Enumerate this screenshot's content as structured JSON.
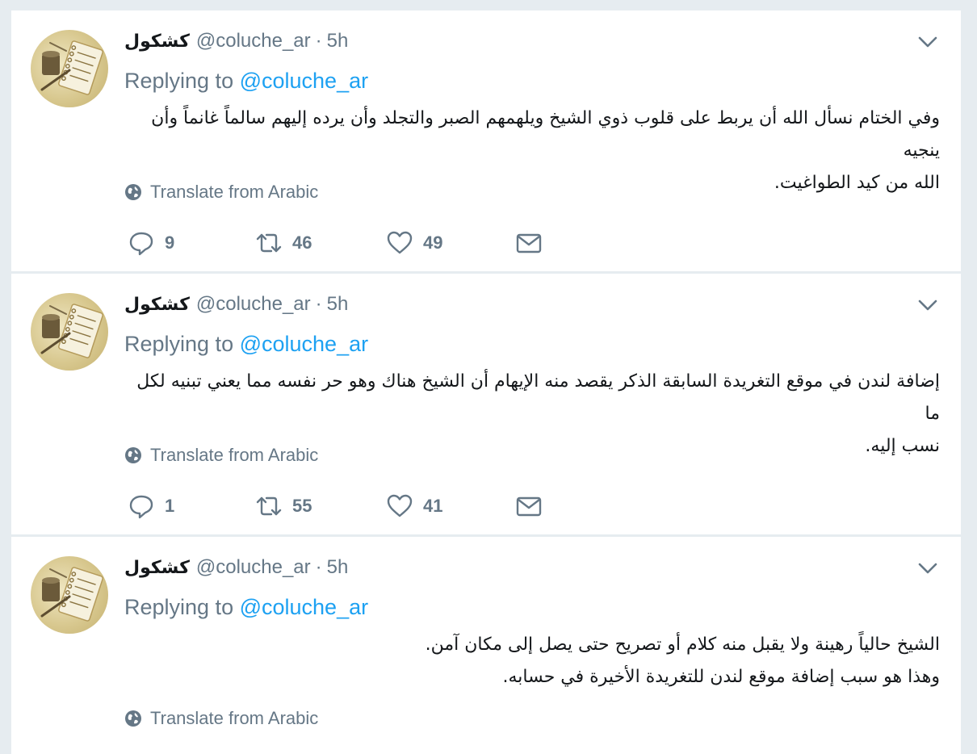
{
  "tweets": [
    {
      "fullname": "كشكول",
      "handle": "@coluche_ar",
      "separator": "·",
      "time": "5h",
      "replying_prefix": "Replying to ",
      "replying_to": "@coluche_ar",
      "lines": [
        "وفي الختام نسأل الله أن يربط على قلوب ذوي الشيخ ويلهمهم الصبر والتجلد وأن يرده إليهم سالماً غانماً وأن ينجيه",
        "الله من كيد الطواغيت."
      ],
      "translate_label": "Translate from Arabic",
      "replies": "9",
      "retweets": "46",
      "likes": "49"
    },
    {
      "fullname": "كشكول",
      "handle": "@coluche_ar",
      "separator": "·",
      "time": "5h",
      "replying_prefix": "Replying to ",
      "replying_to": "@coluche_ar",
      "lines": [
        "إضافة لندن في موقع التغريدة السابقة الذكر يقصد منه الإيهام أن الشيخ هناك وهو حر نفسه مما يعني تبنيه لكل ما",
        "نسب إليه."
      ],
      "translate_label": "Translate from Arabic",
      "replies": "1",
      "retweets": "55",
      "likes": "41"
    },
    {
      "fullname": "كشكول",
      "handle": "@coluche_ar",
      "separator": "·",
      "time": "5h",
      "replying_prefix": "Replying to ",
      "replying_to": "@coluche_ar",
      "lines": [
        "الشيخ حالياً رهينة ولا يقبل منه كلام أو تصريح حتى يصل إلى مكان آمن.",
        "وهذا هو سبب إضافة موقع لندن للتغريدة الأخيرة في حسابه."
      ],
      "translate_label": "Translate from Arabic"
    }
  ],
  "icons": {
    "reply": "reply-icon",
    "retweet": "retweet-icon",
    "like": "heart-icon",
    "dm": "envelope-icon",
    "globe": "globe-icon",
    "caret": "chevron-down-icon"
  },
  "colors": {
    "link": "#1da1f2",
    "muted": "#657786",
    "text": "#14171a",
    "background": "#e6ecf0"
  }
}
